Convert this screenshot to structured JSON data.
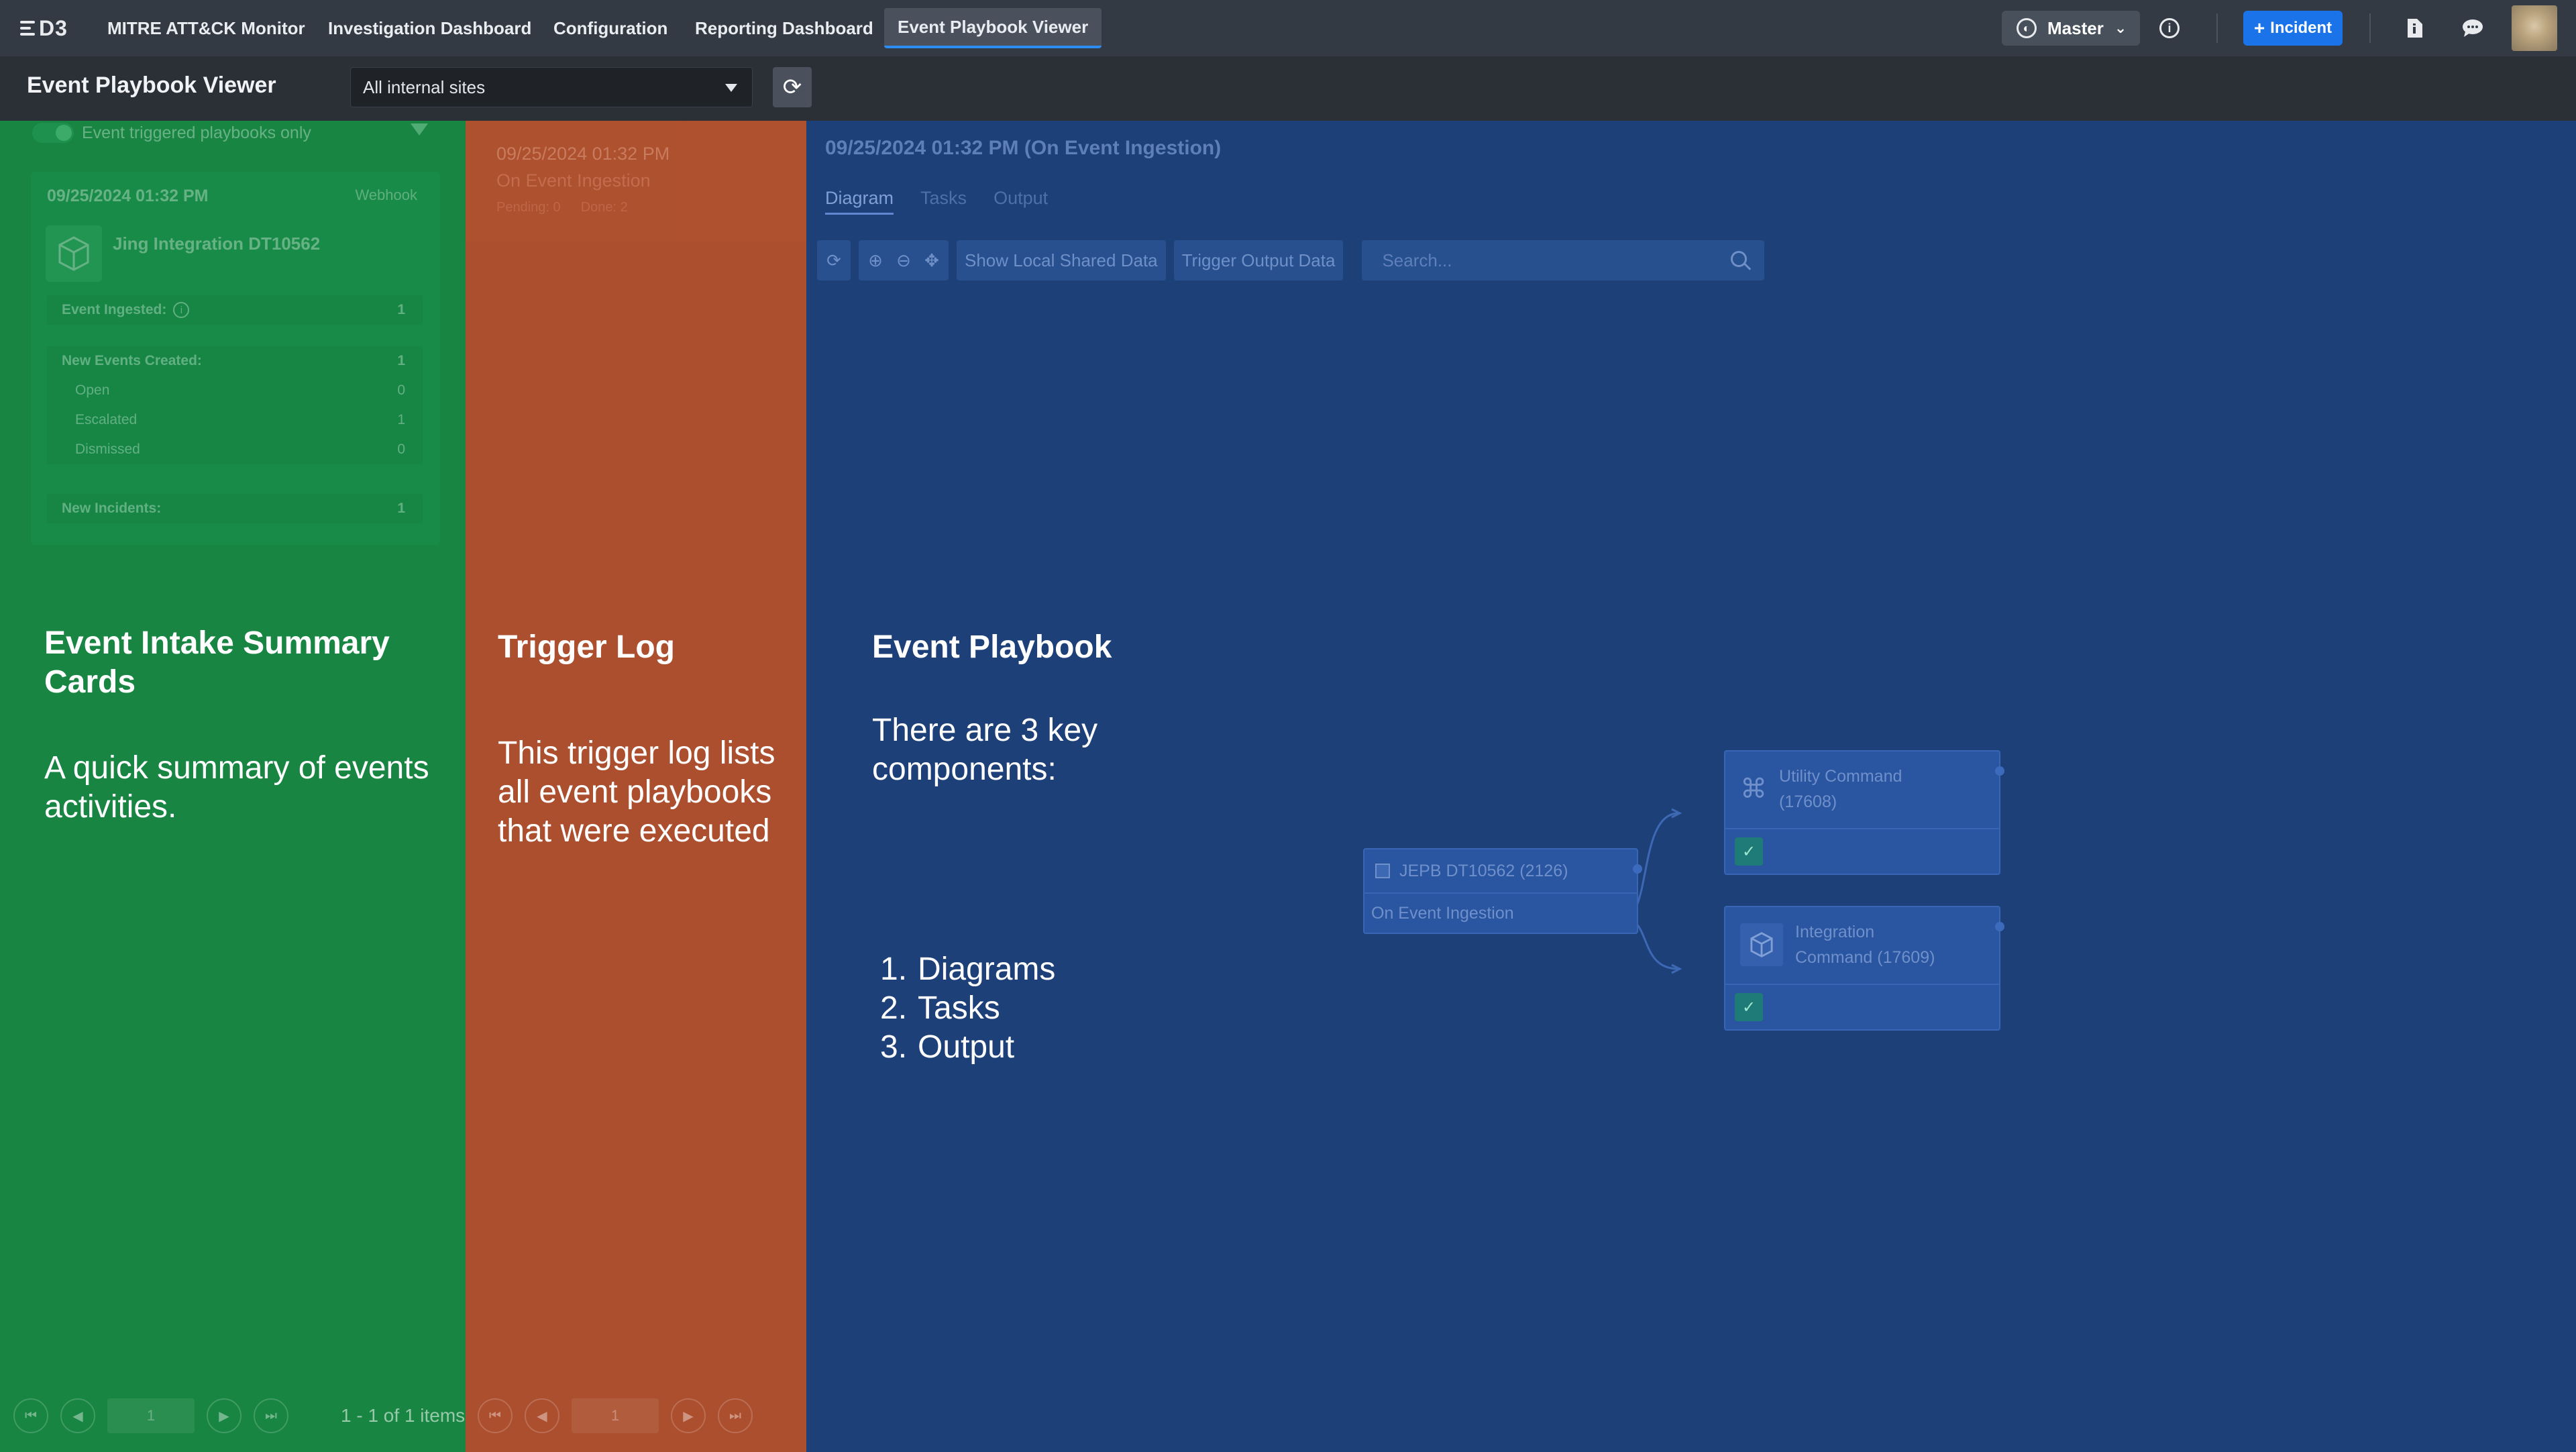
{
  "nav": {
    "logo": "D3",
    "tabs": [
      "MITRE ATT&CK Monitor",
      "Investigation Dashboard",
      "Configuration",
      "Reporting Dashboard",
      "Event Playbook Viewer"
    ],
    "active_tab": "Event Playbook Viewer",
    "site_switch": "Master",
    "new_incident_label": "Incident"
  },
  "subheader": {
    "title": "Event Playbook Viewer",
    "site_select": "All internal sites"
  },
  "intake": {
    "toggle_label": "Event triggered playbooks only",
    "card": {
      "date": "09/25/2024 01:32 PM",
      "tag": "Webhook",
      "name": "Jing Integration DT10562",
      "event_ingested_label": "Event Ingested:",
      "event_ingested_value": "1",
      "new_events_label": "New Events Created:",
      "new_events_value": "1",
      "open_label": "Open",
      "open_value": "0",
      "escalated_label": "Escalated",
      "escalated_value": "1",
      "dismissed_label": "Dismissed",
      "dismissed_value": "0",
      "new_incidents_label": "New Incidents:",
      "new_incidents_value": "1"
    },
    "pager": {
      "page": "1",
      "count": "1 - 1 of 1 items"
    }
  },
  "trigger_log": {
    "item": {
      "date": "09/25/2024 01:32 PM",
      "event": "On Event Ingestion",
      "pending": "Pending: 0",
      "done": "Done: 2"
    },
    "pager": {
      "page": "1"
    }
  },
  "playbook": {
    "title": "09/25/2024 01:32 PM (On Event Ingestion)",
    "tabs": [
      "Diagram",
      "Tasks",
      "Output"
    ],
    "toolbar": {
      "show_local": "Show Local Shared Data",
      "trigger_output": "Trigger Output Data",
      "search_placeholder": "Search..."
    },
    "nodes": {
      "root_title": "JEPB DT10562 (2126)",
      "root_sub": "On Event Ingestion",
      "utility_line1": "Utility Command",
      "utility_line2": "(17608)",
      "integration_line1": "Integration",
      "integration_line2": "Command (17609)"
    }
  },
  "annotations": {
    "green": {
      "title": "Event Intake Summary Cards",
      "body": "A quick summary of events activities."
    },
    "orange": {
      "title": "Trigger Log",
      "body": "This trigger log lists all event playbooks that were executed"
    },
    "blue": {
      "title": "Event Playbook",
      "body": "There are 3 key components:",
      "items": [
        "Diagrams",
        "Tasks",
        "Output"
      ]
    }
  },
  "colors": {
    "green_overlay": "#188543",
    "orange_overlay": "#ac4f2e",
    "blue_overlay": "#1e4079",
    "accent": "#1a73e8"
  }
}
